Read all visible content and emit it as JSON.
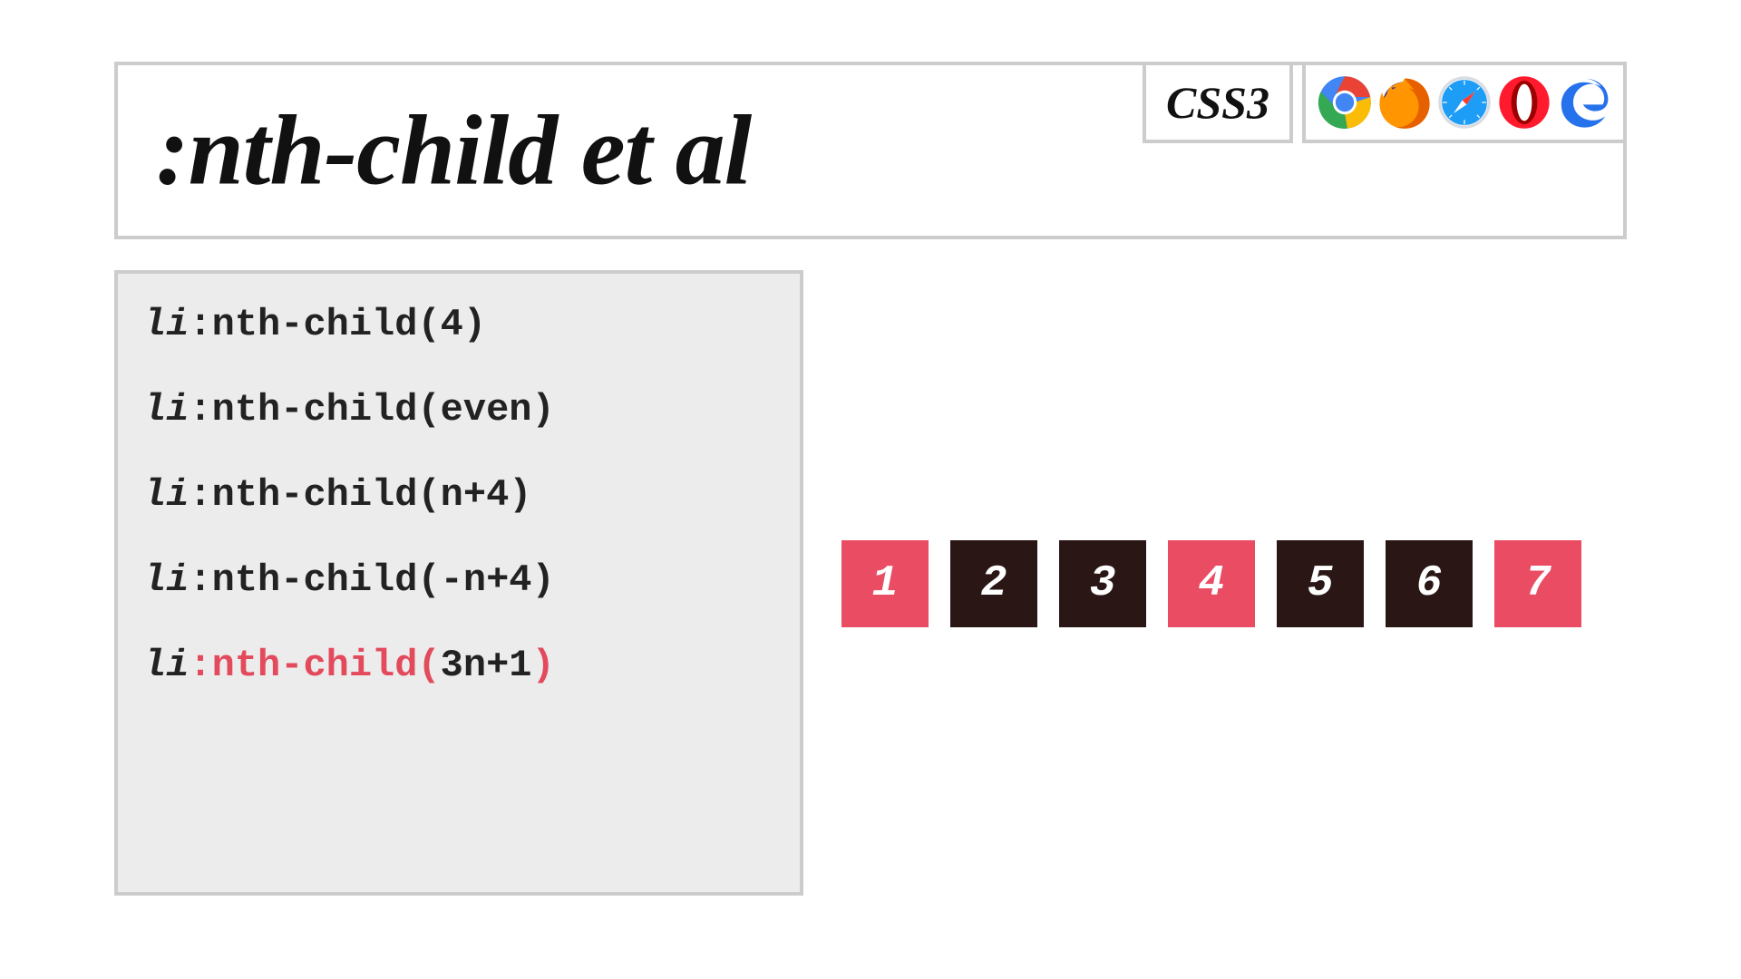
{
  "header": {
    "title": ":nth-child et al",
    "css_version": "CSS3",
    "browsers": [
      "chrome",
      "firefox",
      "safari",
      "opera",
      "edge"
    ]
  },
  "code": {
    "lines": [
      {
        "tag": "li",
        "sel": ":nth-child(",
        "arg": "4",
        "close": ")",
        "highlighted": false
      },
      {
        "tag": "li",
        "sel": ":nth-child(",
        "arg": "even",
        "close": ")",
        "highlighted": false
      },
      {
        "tag": "li",
        "sel": ":nth-child(",
        "arg": "n+4",
        "close": ")",
        "highlighted": false
      },
      {
        "tag": "li",
        "sel": ":nth-child(",
        "arg": "-n+4",
        "close": ")",
        "highlighted": false
      },
      {
        "tag": "li",
        "sel": ":nth-child(",
        "arg": "3n+1",
        "close": ")",
        "highlighted": true
      }
    ]
  },
  "demo": {
    "items": [
      {
        "n": "1",
        "matched": true
      },
      {
        "n": "2",
        "matched": false
      },
      {
        "n": "3",
        "matched": false
      },
      {
        "n": "4",
        "matched": true
      },
      {
        "n": "5",
        "matched": false
      },
      {
        "n": "6",
        "matched": false
      },
      {
        "n": "7",
        "matched": true
      }
    ]
  },
  "colors": {
    "match": "#ea4c63",
    "nomatch": "#2b1616",
    "panel_border": "#cccccc",
    "panel_bg": "#ececec"
  }
}
